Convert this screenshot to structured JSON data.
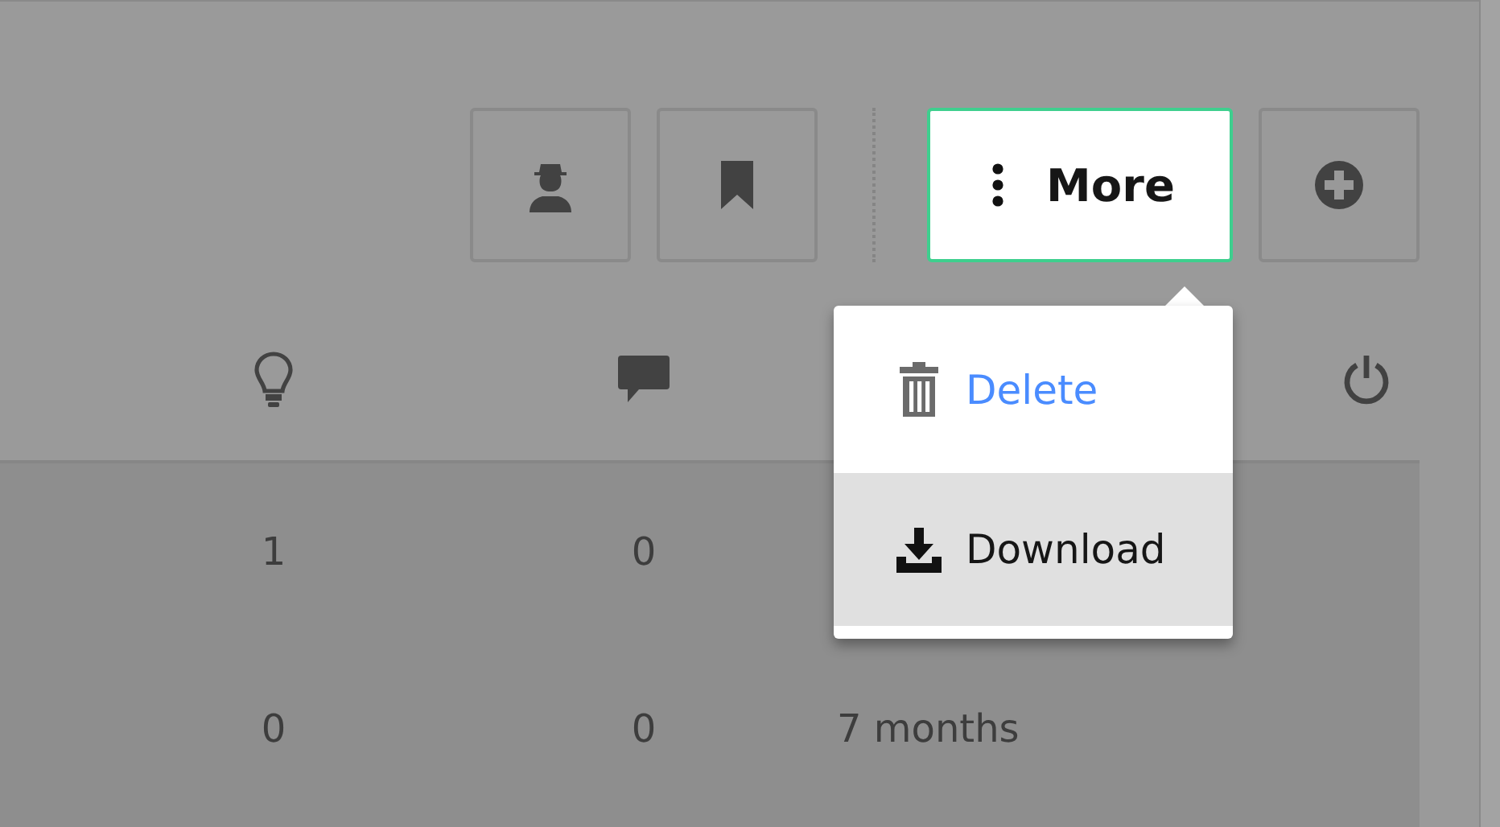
{
  "toolbar": {
    "more_button": {
      "label": "More",
      "selected": true
    }
  },
  "menu": {
    "open": true,
    "items": [
      {
        "kind": "delete",
        "label": "Delete",
        "selected": false
      },
      {
        "kind": "download",
        "label": "Download",
        "selected": true
      }
    ]
  },
  "table": {
    "rows": [
      {
        "cells": [
          "1",
          "0"
        ]
      },
      {
        "cells": [
          "0",
          "0",
          "7 months"
        ]
      }
    ]
  }
}
